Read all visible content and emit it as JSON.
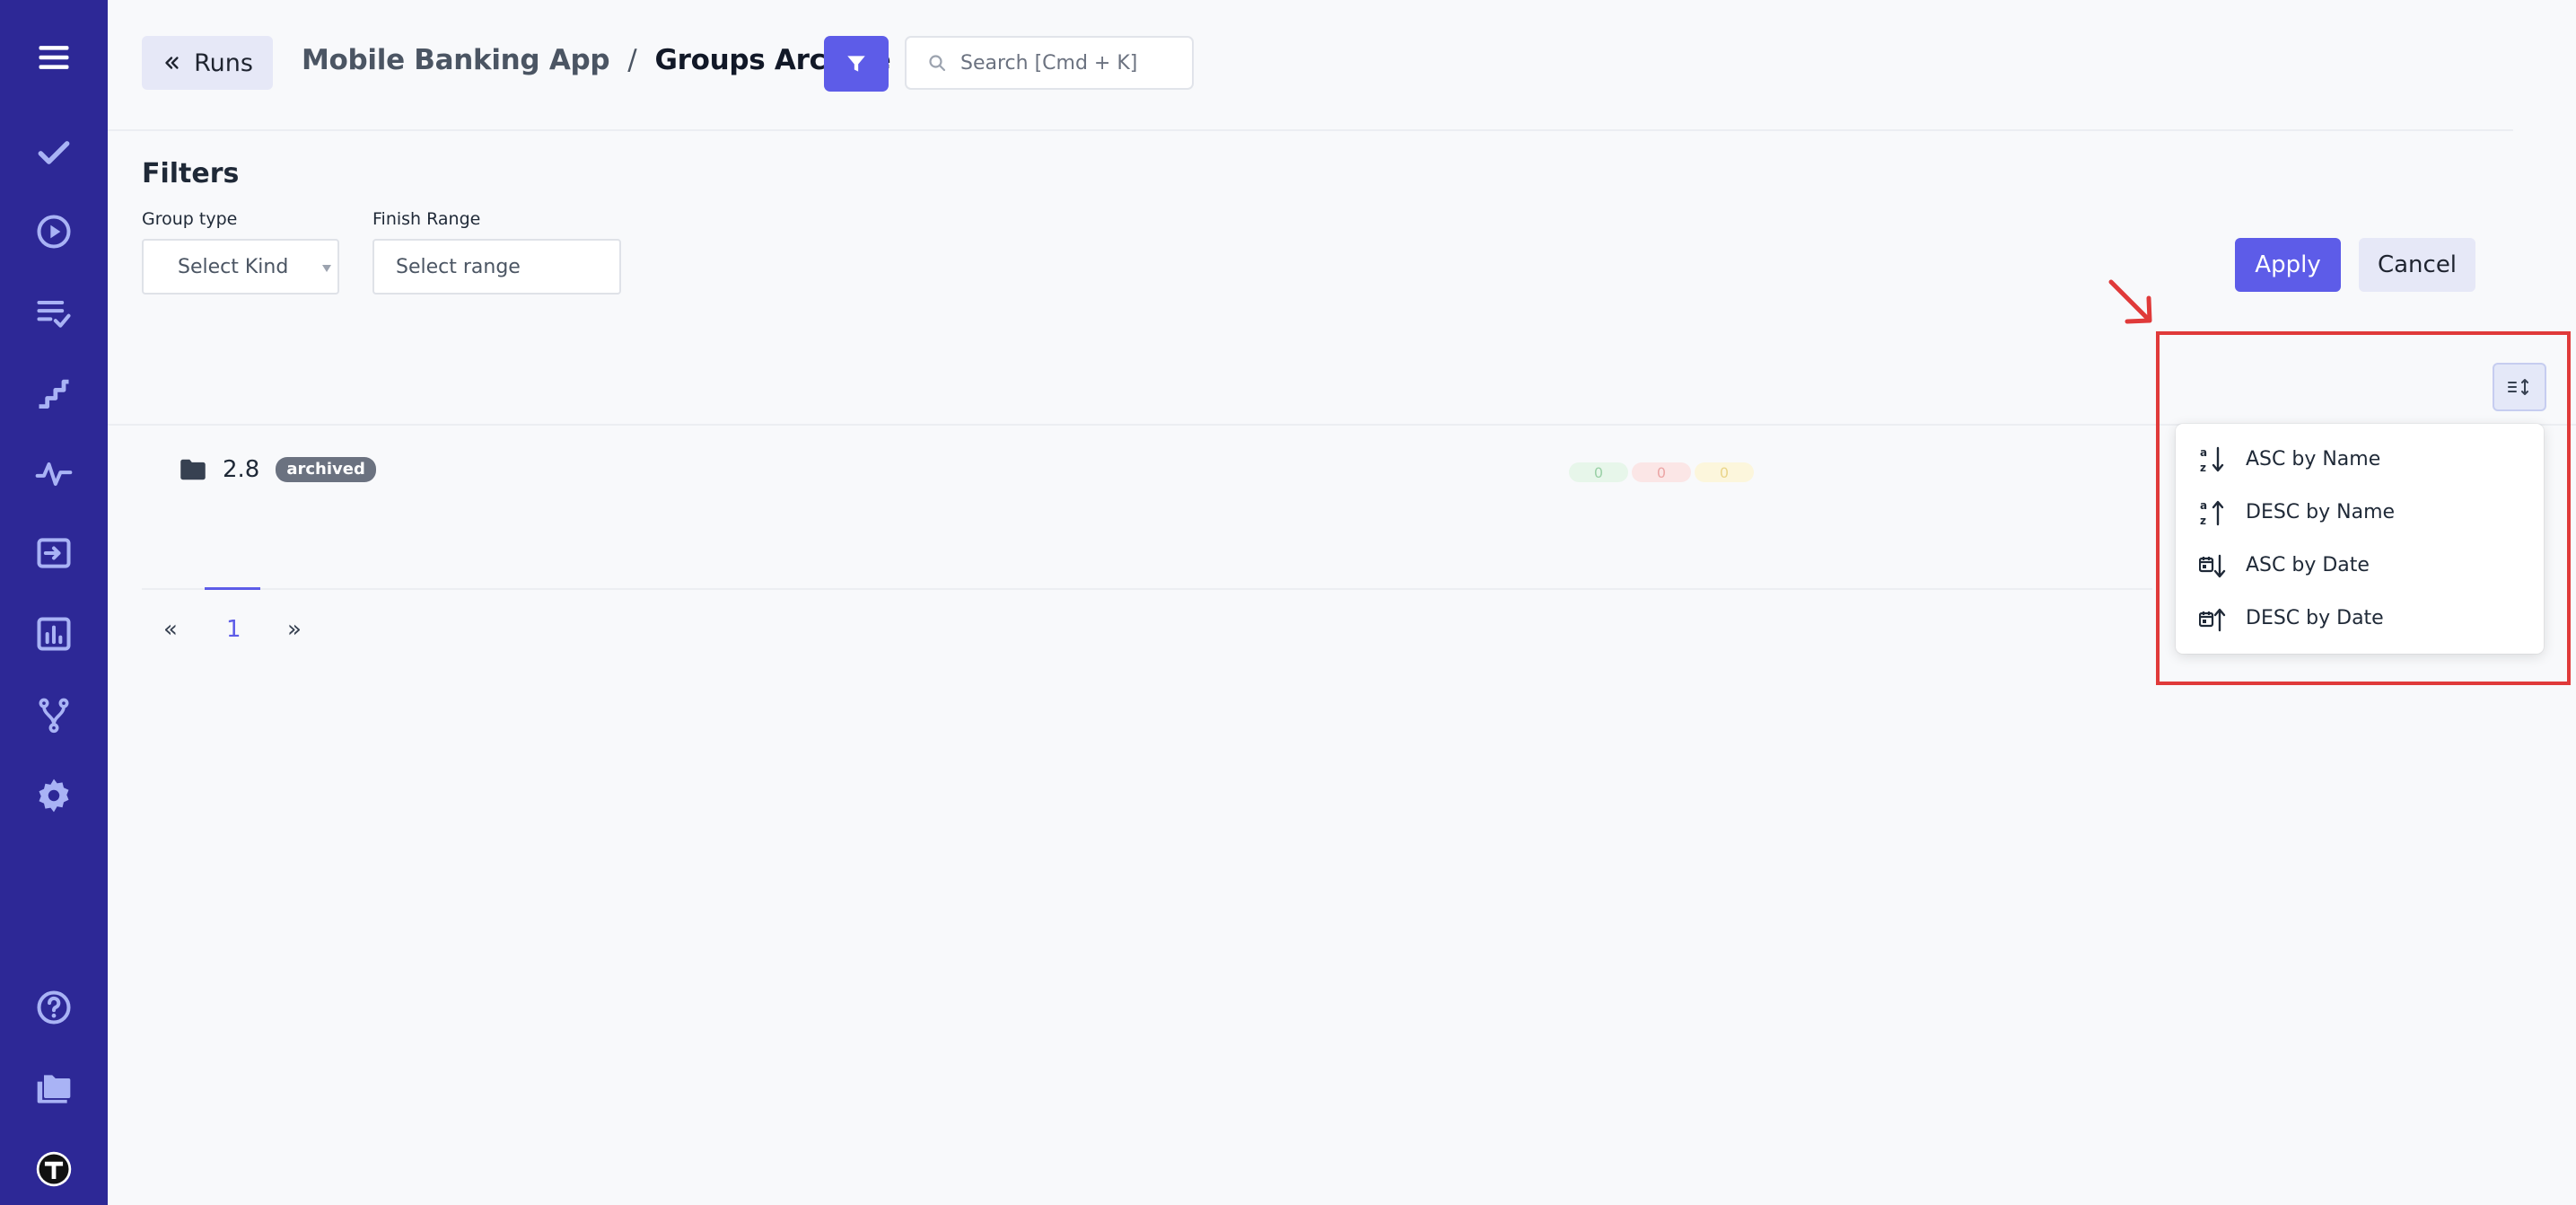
{
  "colors": {
    "sidebar_bg": "#2d2896",
    "sidebar_icon": "#a9b3f5",
    "accent": "#5d5ce8",
    "secondary_btn": "#e6e8f7",
    "highlight_border": "#e03a3a"
  },
  "sidebar": {
    "items": [
      {
        "icon": "hamburger-menu-icon"
      },
      {
        "icon": "checkmark-icon"
      },
      {
        "icon": "play-circle-icon"
      },
      {
        "icon": "list-check-icon"
      },
      {
        "icon": "stairs-icon"
      },
      {
        "icon": "pulse-icon"
      },
      {
        "icon": "import-icon"
      },
      {
        "icon": "bar-chart-icon"
      },
      {
        "icon": "branch-icon"
      },
      {
        "icon": "gear-icon"
      },
      {
        "icon": "help-circle-icon"
      },
      {
        "icon": "folders-icon"
      },
      {
        "icon": "app-logo-icon"
      }
    ]
  },
  "header": {
    "runs_button": "Runs",
    "project": "Mobile Banking App",
    "separator": "/",
    "page": "Groups Archive",
    "search_placeholder": "Search [Cmd + K]"
  },
  "filters": {
    "title": "Filters",
    "group_type_label": "Group type",
    "group_type_value": "Select Kind",
    "finish_range_label": "Finish Range",
    "finish_range_value": "Select range",
    "apply": "Apply",
    "cancel": "Cancel"
  },
  "groups": [
    {
      "name": "2.8",
      "badge": "archived",
      "counters": [
        {
          "value": "0",
          "status": "passed",
          "color": "#9ad0a6",
          "bg": "#e7f6ea"
        },
        {
          "value": "0",
          "status": "failed",
          "color": "#eba5a5",
          "bg": "#fbe6e6"
        },
        {
          "value": "0",
          "status": "skipped",
          "color": "#ead58a",
          "bg": "#fcf6dc"
        }
      ]
    }
  ],
  "pagination": {
    "prev": "«",
    "current": "1",
    "next": "»"
  },
  "sort_menu": {
    "items": [
      {
        "label": "ASC by Name",
        "icon": "sort-alpha-asc-icon"
      },
      {
        "label": "DESC by Name",
        "icon": "sort-alpha-desc-icon"
      },
      {
        "label": "ASC by Date",
        "icon": "sort-date-asc-icon"
      },
      {
        "label": "DESC by Date",
        "icon": "sort-date-desc-icon"
      }
    ]
  }
}
